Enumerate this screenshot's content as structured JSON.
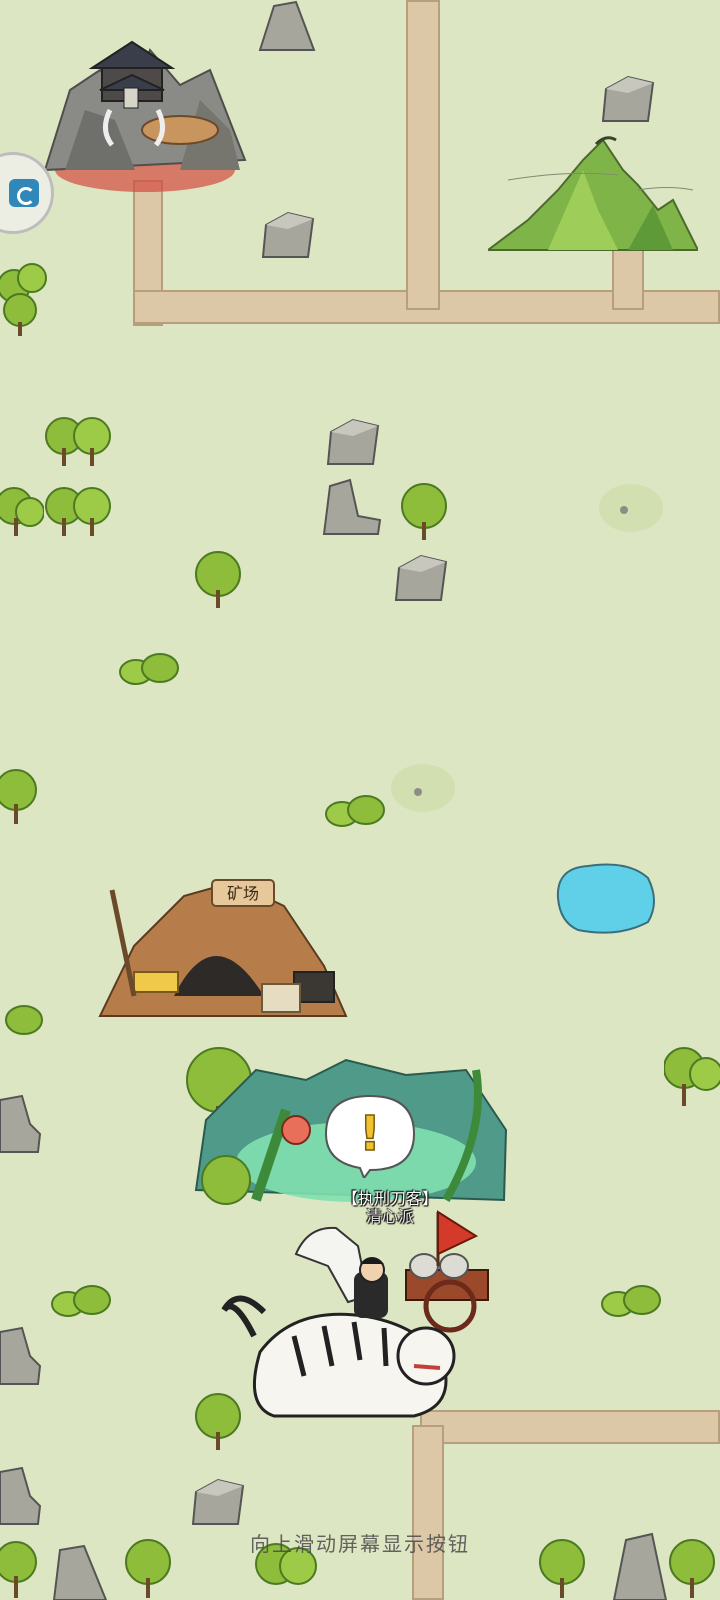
{
  "hint_text": "向上滑动屏幕显示按钮",
  "npc": {
    "title": "【执刑刀客】",
    "sect": "清心派"
  },
  "quest_marker": "!",
  "map_landmarks": {
    "mine_sign": "矿场"
  },
  "colors": {
    "background": "#dde6c2",
    "path": "#dcc7a6",
    "tree": "#8dbd3b",
    "rock": "#9e9e96",
    "pond": "#5fd0e8",
    "marker": "#f2c12e"
  },
  "icons": {
    "side_button": "menu-shortcut-icon"
  }
}
